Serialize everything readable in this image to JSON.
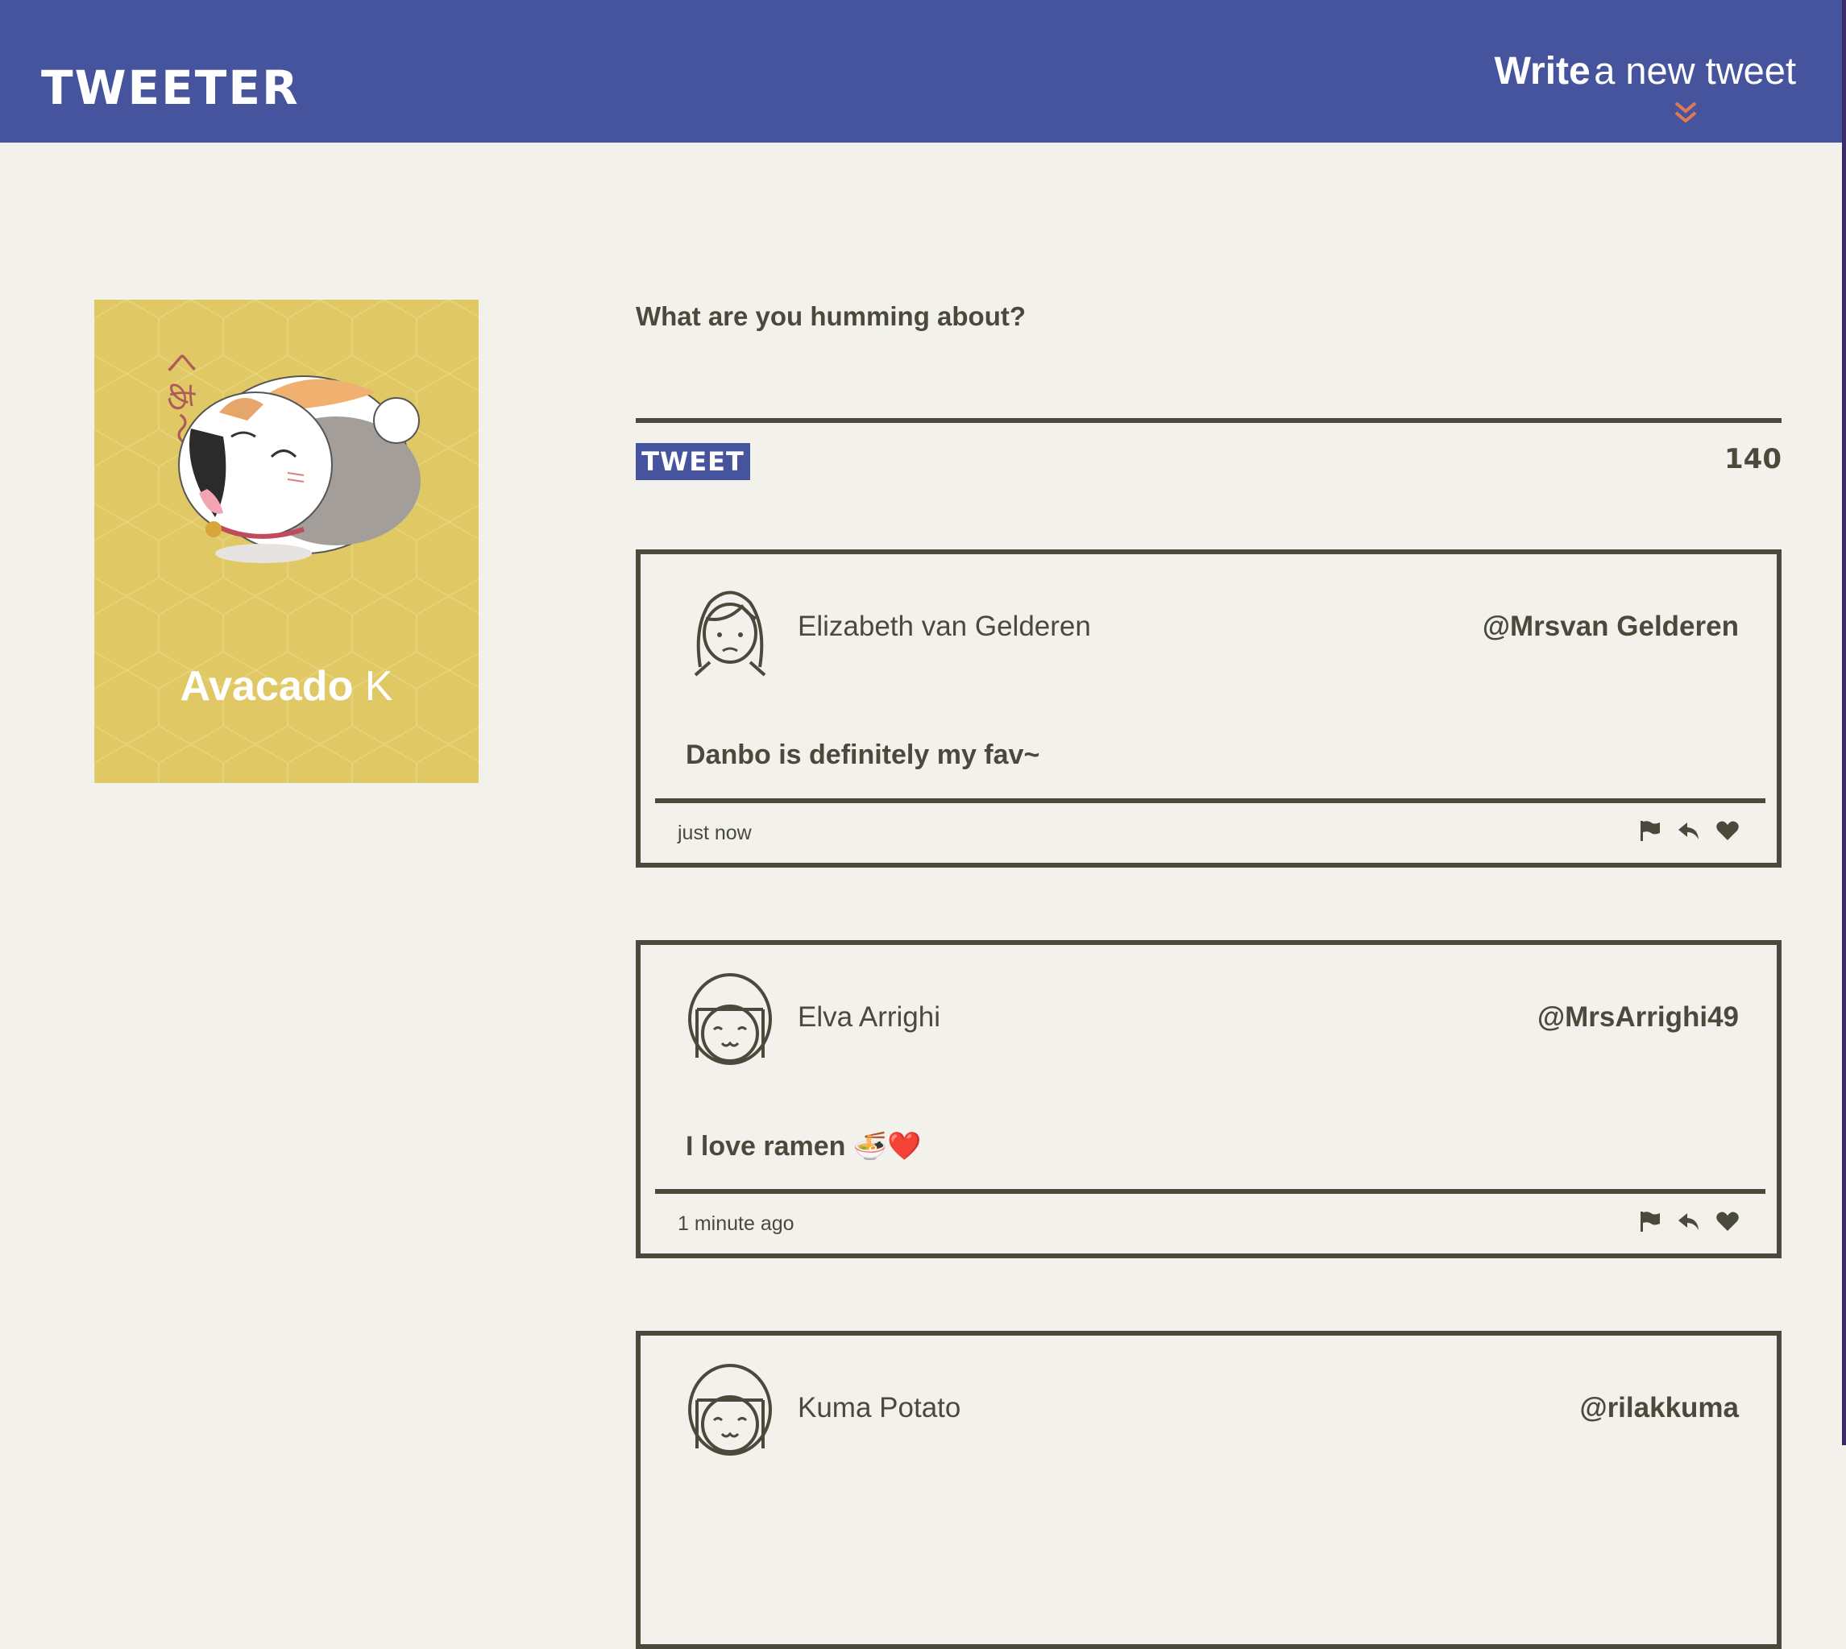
{
  "header": {
    "brand": "TWEETER",
    "compose_strong": "Write",
    "compose_rest": "a new tweet"
  },
  "profile": {
    "first_name": "Avacado",
    "last_name": "K",
    "art_text": "くあ〜"
  },
  "composer": {
    "placeholder": "What are you humming about?",
    "button_label": "TWEET",
    "counter": "140"
  },
  "tweets": [
    {
      "name": "Elizabeth van Gelderen",
      "handle": "@Mrsvan Gelderen",
      "body": "Danbo is definitely my fav~",
      "time": "just now"
    },
    {
      "name": "Elva Arrighi",
      "handle": "@MrsArrighi49",
      "body": "I love ramen 🍜❤️",
      "time": "1 minute ago"
    },
    {
      "name": "Kuma Potato",
      "handle": "@rilakkuma",
      "body": "",
      "time": ""
    }
  ],
  "colors": {
    "nav": "#46549e",
    "background": "#f2f1ec",
    "text": "#4a4a3c",
    "profile_card": "#e0c964",
    "accent_chevron": "#e07a55"
  }
}
